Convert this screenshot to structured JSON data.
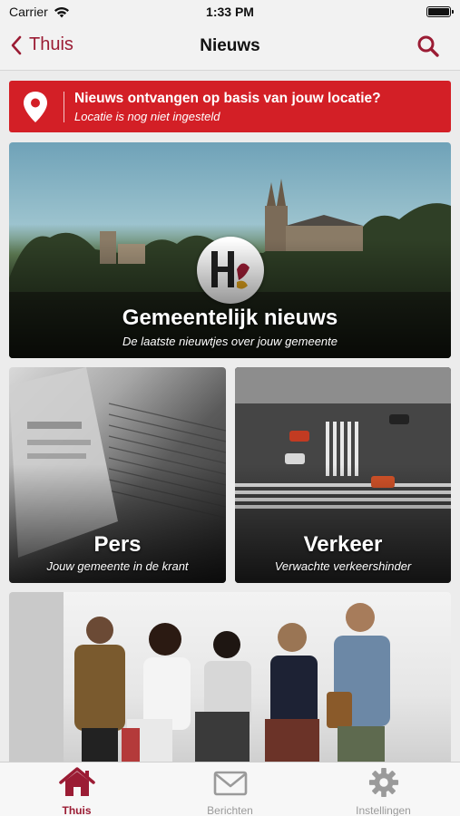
{
  "status_bar": {
    "carrier": "Carrier",
    "time": "1:33 PM"
  },
  "nav": {
    "back_label": "Thuis",
    "title": "Nieuws"
  },
  "location_banner": {
    "title": "Nieuws ontvangen op basis van jouw locatie?",
    "subtitle": "Locatie is nog niet ingesteld"
  },
  "cards": {
    "gemeente": {
      "title": "Gemeentelijk nieuws",
      "subtitle": "De laatste nieuwtjes over jouw gemeente"
    },
    "pers": {
      "title": "Pers",
      "subtitle": "Jouw gemeente in de krant"
    },
    "verkeer": {
      "title": "Verkeer",
      "subtitle": "Verwachte verkeershinder"
    }
  },
  "tabs": [
    {
      "label": "Thuis",
      "icon": "house-icon",
      "active": true
    },
    {
      "label": "Berichten",
      "icon": "envelope-icon",
      "active": false
    },
    {
      "label": "Instellingen",
      "icon": "gear-icon",
      "active": false
    }
  ],
  "colors": {
    "accent": "#9b1c34",
    "banner": "#d31f26",
    "inactive": "#9a9a9a"
  }
}
